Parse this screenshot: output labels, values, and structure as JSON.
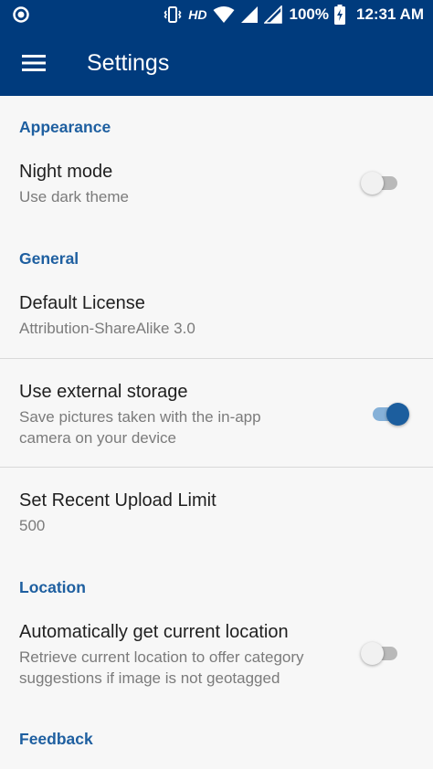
{
  "status_bar": {
    "network_label": "HD",
    "battery": "100%",
    "time": "12:31 AM"
  },
  "app_bar": {
    "title": "Settings"
  },
  "sections": {
    "appearance": {
      "header": "Appearance",
      "night_mode": {
        "title": "Night mode",
        "summary": "Use dark theme",
        "enabled": false
      }
    },
    "general": {
      "header": "General",
      "default_license": {
        "title": "Default License",
        "summary": "Attribution-ShareAlike 3.0"
      },
      "external_storage": {
        "title": "Use external storage",
        "summary_line1": "Save pictures taken with the in-app",
        "summary_line2": "camera on your device",
        "enabled": true
      },
      "upload_limit": {
        "title": "Set Recent Upload Limit",
        "summary": "500"
      }
    },
    "location": {
      "header": "Location",
      "auto_location": {
        "title": "Automatically get current location",
        "summary_line1": "Retrieve current location to offer category",
        "summary_line2": "suggestions if image is not geotagged",
        "enabled": false
      }
    },
    "feedback": {
      "header": "Feedback"
    }
  },
  "colors": {
    "app_bar": "#003b7d",
    "accent": "#1e5fa0",
    "switch_on_thumb": "#1c5e9e",
    "switch_on_track": "#86b1d8",
    "background": "#f7f7f7"
  },
  "icons": {
    "menu": "hamburger-menu-icon",
    "status_app": "circle-notification-icon",
    "vibrate": "vibrate-icon",
    "wifi": "wifi-icon",
    "signal": "cell-signal-icon",
    "battery": "battery-charging-icon"
  }
}
